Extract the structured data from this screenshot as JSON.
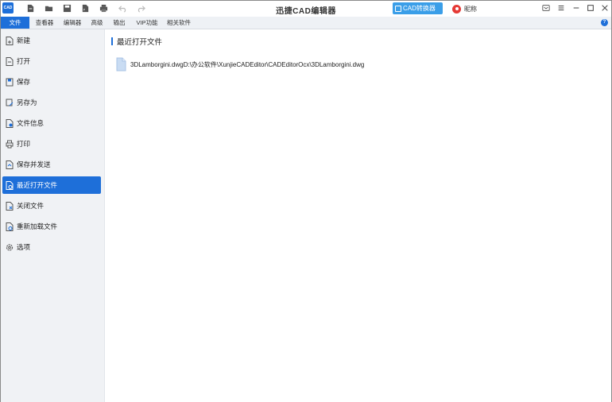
{
  "app": {
    "logo_text": "CAD",
    "title": "迅捷CAD编辑器",
    "converter_label": "CAD转换器",
    "user_name": "昵称"
  },
  "quick_access": [
    "new-file-icon",
    "open-folder-icon",
    "save-icon",
    "export-pdf-icon",
    "print-icon",
    "undo-icon",
    "redo-icon"
  ],
  "ribbon_tabs": [
    {
      "label": "文件",
      "active": true
    },
    {
      "label": "查看器"
    },
    {
      "label": "编辑器"
    },
    {
      "label": "高级"
    },
    {
      "label": "输出"
    },
    {
      "label": "VIP功能"
    },
    {
      "label": "相关软件"
    }
  ],
  "sidebar": {
    "items": [
      {
        "label": "新建",
        "icon": "new-file-icon"
      },
      {
        "label": "打开",
        "icon": "open-file-icon"
      },
      {
        "label": "保存",
        "icon": "save-icon"
      },
      {
        "label": "另存为",
        "icon": "save-as-icon"
      },
      {
        "label": "文件信息",
        "icon": "file-info-icon"
      },
      {
        "label": "打印",
        "icon": "print-icon"
      },
      {
        "label": "保存并发送",
        "icon": "save-send-icon"
      },
      {
        "label": "最近打开文件",
        "icon": "recent-files-icon",
        "active": true
      },
      {
        "label": "关闭文件",
        "icon": "close-file-icon"
      },
      {
        "label": "重新加载文件",
        "icon": "reload-file-icon"
      },
      {
        "label": "选项",
        "icon": "options-gear-icon"
      }
    ]
  },
  "main": {
    "section_title": "最近打开文件",
    "recent_files": [
      {
        "text": "3DLamborgini.dwgD:\\办公软件\\XunjieCADEditor\\CADEditorOcx\\3DLamborgini.dwg"
      }
    ]
  },
  "colors": {
    "accent": "#1e6fd9",
    "converter": "#3a9ee8",
    "sidebar_bg": "#f0f2f5",
    "avatar": "#e53935"
  }
}
